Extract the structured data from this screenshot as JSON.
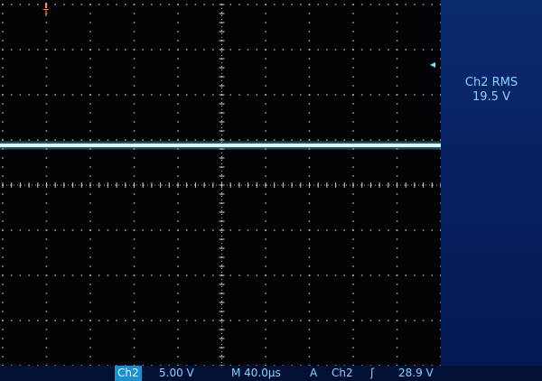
{
  "measurement": {
    "label": "Ch2 RMS",
    "value": "19.5 V"
  },
  "trigger_marker": {
    "glyph": "T"
  },
  "level_marker": {
    "glyph": "◂"
  },
  "status_bar": {
    "channel": "Ch2",
    "volts_per_div": "5.00 V",
    "timebase": "M 40.0µs",
    "acquire_mode": "A",
    "trigger_source": "Ch2",
    "trigger_slope": "ʃ",
    "trigger_level": "28.9 V"
  },
  "colors": {
    "waveform": "#6fe3ff",
    "grid": "#c8c8c8",
    "trigger_marker": "#ff8a3c",
    "text": "#8ad2ff"
  }
}
